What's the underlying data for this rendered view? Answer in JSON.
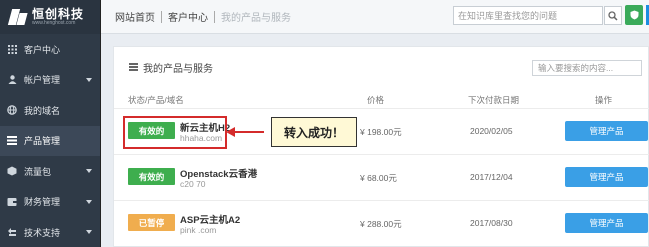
{
  "brand": {
    "name": "恒创科技",
    "sub": "www.henghost.com"
  },
  "sidebar": {
    "items": [
      {
        "label": "客户中心",
        "icon": "grid-icon",
        "caret": false,
        "active": false
      },
      {
        "label": "帐户管理",
        "icon": "user-icon",
        "caret": true,
        "active": false
      },
      {
        "label": "我的域名",
        "icon": "globe-icon",
        "caret": false,
        "active": false
      },
      {
        "label": "产品管理",
        "icon": "list-icon",
        "caret": false,
        "active": true
      },
      {
        "label": "流量包",
        "icon": "box-icon",
        "caret": true,
        "active": false
      },
      {
        "label": "财务管理",
        "icon": "finance-icon",
        "caret": true,
        "active": false
      },
      {
        "label": "技术支持",
        "icon": "support-icon",
        "caret": true,
        "active": false
      }
    ]
  },
  "topbar": {
    "home": "网站首页",
    "center": "客户中心",
    "current": "我的产品与服务",
    "search_placeholder": "在知识库里查找您的问题"
  },
  "panel": {
    "title": "我的产品与服务",
    "search_placeholder": "输入要搜索的内容..."
  },
  "table": {
    "headers": {
      "status": "状态/产品/域名",
      "price": "价格",
      "date": "下次付款日期",
      "action": "操作"
    },
    "rows": [
      {
        "status": "有效的",
        "status_color": "#3eae4e",
        "name": "新云主机H2",
        "domain": "hhaha.com",
        "price": "¥ 198.00元",
        "date": "2020/02/05",
        "action": "管理产品"
      },
      {
        "status": "有效的",
        "status_color": "#3eae4e",
        "name": "Openstack云香港",
        "domain": "c20               70",
        "price": "¥ 68.00元",
        "date": "2017/12/04",
        "action": "管理产品"
      },
      {
        "status": "已暂停",
        "status_color": "#f0ad4e",
        "name": "ASP云主机A2",
        "domain": "pink                .com",
        "price": "¥ 288.00元",
        "date": "2017/08/30",
        "action": "管理产品"
      }
    ]
  },
  "annotation": {
    "text": "转入成功！",
    "color": "#d42b2b"
  }
}
